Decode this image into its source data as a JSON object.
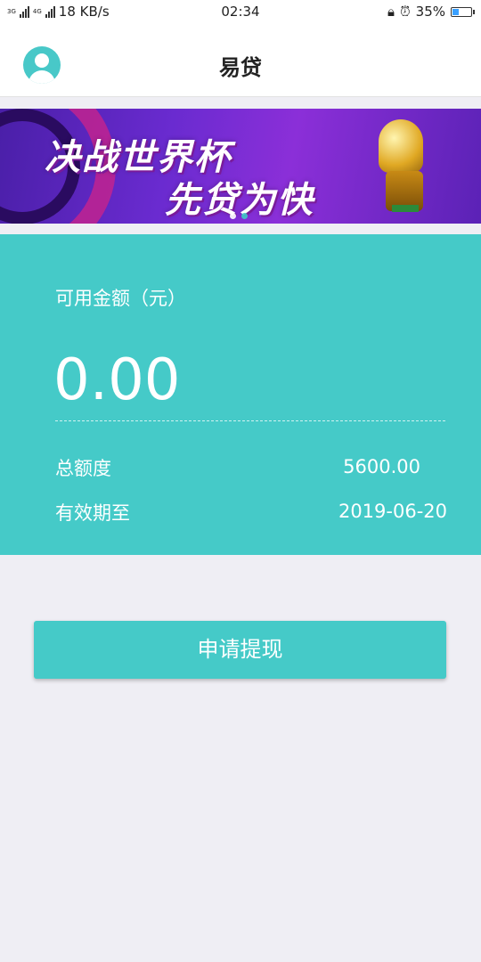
{
  "status_bar": {
    "network_left": "3G",
    "network_right": "4G",
    "speed": "18 KB/s",
    "time": "02:34",
    "battery": "35%",
    "battery_level": 0.35
  },
  "header": {
    "title": "易贷"
  },
  "banner": {
    "line1": "决战世界杯",
    "line2": "先贷为快",
    "page_indicator": {
      "count": 2,
      "active": 1
    }
  },
  "credit": {
    "available_label": "可用金额（元）",
    "available_amount": "0.00",
    "total_label": "总额度",
    "total_value": "5600.00",
    "expiry_label": "有效期至",
    "expiry_value": "2019-06-20"
  },
  "actions": {
    "withdraw_label": "申请提现"
  },
  "colors": {
    "accent": "#45cac8",
    "background": "#efeef4"
  }
}
